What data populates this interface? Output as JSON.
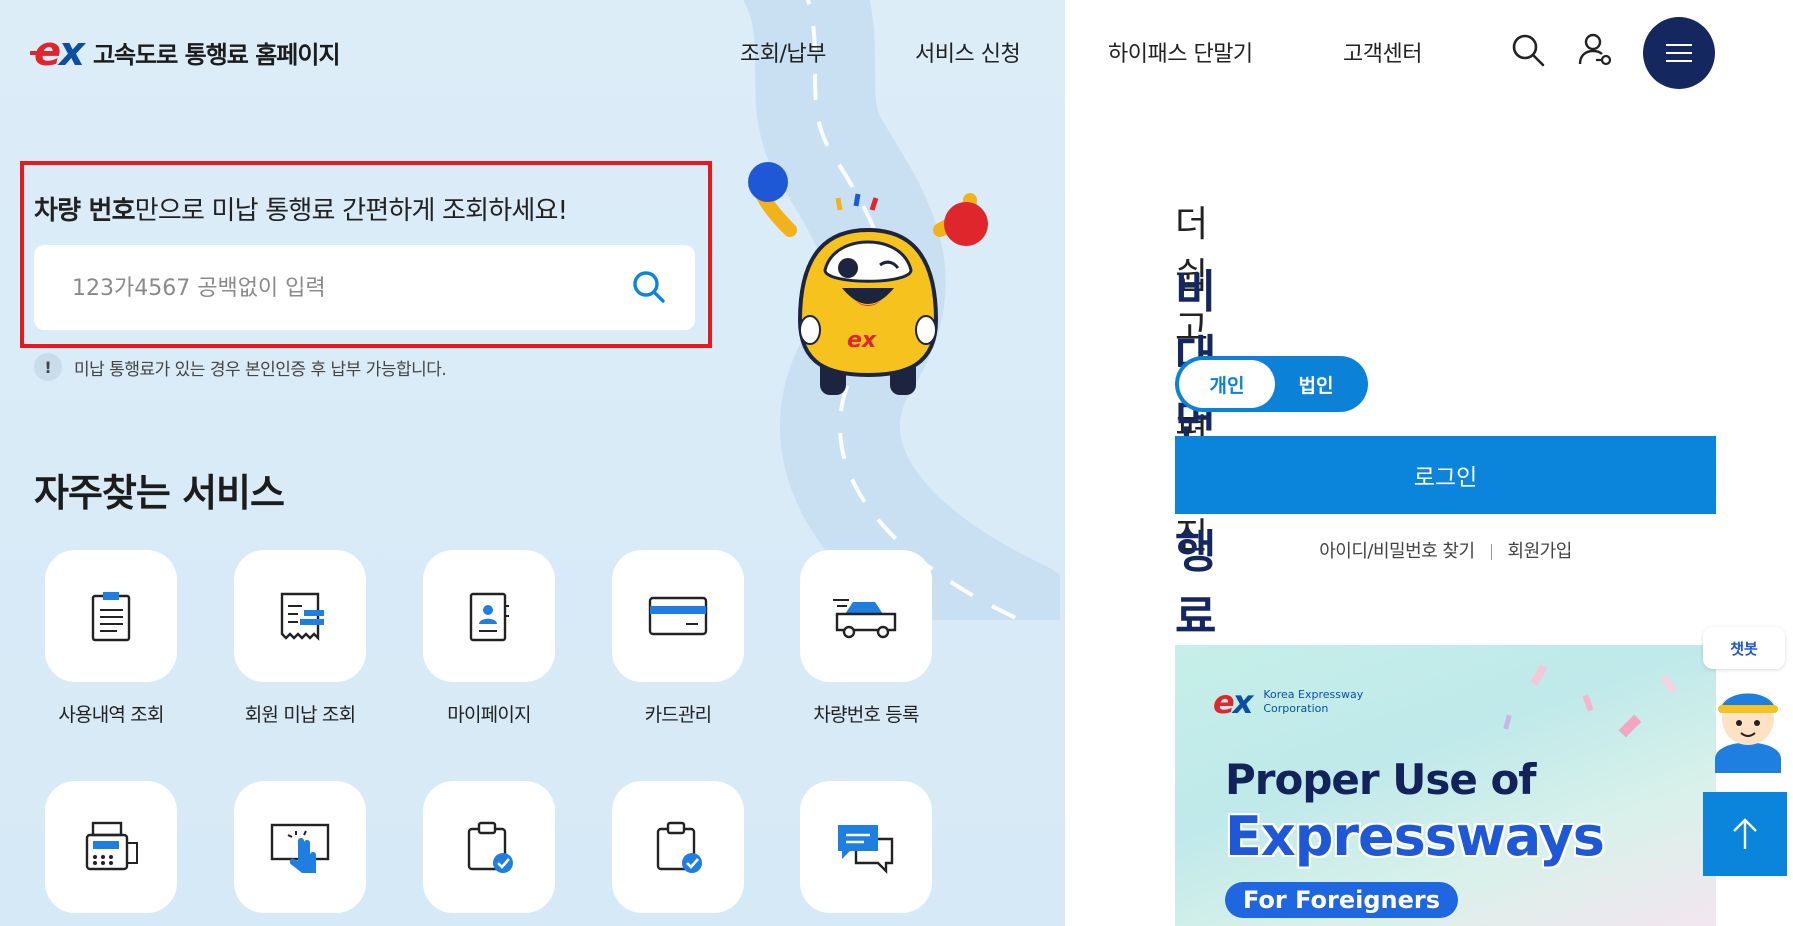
{
  "header": {
    "logo_mark": "ex",
    "site_title": "고속도로 통행료 홈페이지",
    "nav": [
      "조회/납부",
      "서비스 신청",
      "하이패스 단말기",
      "고객센터"
    ]
  },
  "search": {
    "title_bold": "차량 번호",
    "title_rest": "만으로 미납 통행료 간편하게 조회하세요!",
    "placeholder": "123가4567 공백없이 입력",
    "notice_icon": "!",
    "notice": "미납 통행료가 있는 경우 본인인증 후 납부 가능합니다."
  },
  "mascot": {
    "badge": "ex"
  },
  "favorites": {
    "title": "자주찾는 서비스",
    "items": [
      {
        "label": "사용내역 조회",
        "icon": "clipboard-list-icon"
      },
      {
        "label": "회원 미납 조회",
        "icon": "receipt-icon"
      },
      {
        "label": "마이페이지",
        "icon": "profile-card-icon"
      },
      {
        "label": "카드관리",
        "icon": "credit-card-icon"
      },
      {
        "label": "차량번호 등록",
        "icon": "car-icon"
      },
      {
        "label": "",
        "icon": "kiosk-icon"
      },
      {
        "label": "",
        "icon": "touch-screen-icon"
      },
      {
        "label": "",
        "icon": "clipboard-check-icon"
      },
      {
        "label": "",
        "icon": "clipboard-check-icon"
      },
      {
        "label": "",
        "icon": "chat-icon"
      }
    ]
  },
  "promo": {
    "subtitle": "더 쉽고 간편해진",
    "title": "비대면 통행료 서비스",
    "toggle": [
      "개인",
      "법인"
    ],
    "login": "로그인",
    "find_id": "아이디/비밀번호 찾기",
    "signup": "회원가입"
  },
  "banner": {
    "logo": "ex",
    "corp_line1": "Korea Expressway",
    "corp_line2": "Corporation",
    "line1": "Proper Use of",
    "line2": "Expressways",
    "tag": "For Foreigners"
  },
  "chatbot": {
    "label": "챗봇"
  },
  "colors": {
    "navy": "#14285f",
    "blue": "#0a85db",
    "red": "#e0262d",
    "highlight": "#e8191e"
  }
}
